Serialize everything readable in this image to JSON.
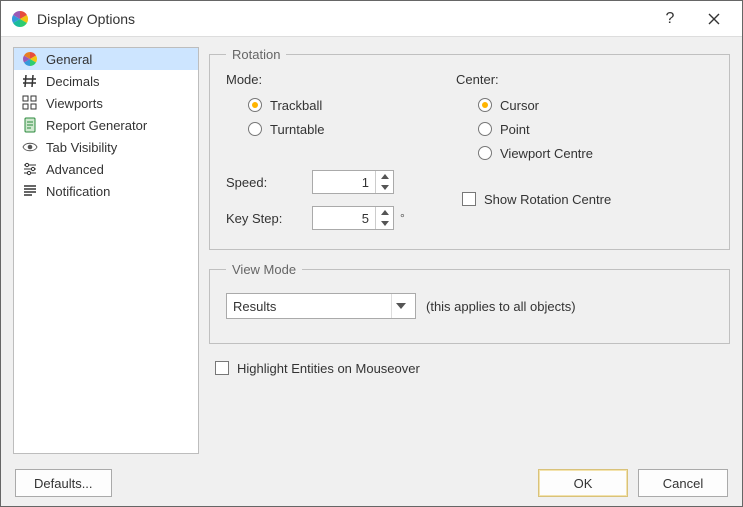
{
  "window": {
    "title": "Display Options"
  },
  "sidebar": {
    "items": [
      {
        "label": "General",
        "selected": true
      },
      {
        "label": "Decimals"
      },
      {
        "label": "Viewports"
      },
      {
        "label": "Report Generator"
      },
      {
        "label": "Tab Visibility"
      },
      {
        "label": "Advanced"
      },
      {
        "label": "Notification"
      }
    ]
  },
  "rotation": {
    "legend": "Rotation",
    "mode_label": "Mode:",
    "mode_options": {
      "trackball": "Trackball",
      "turntable": "Turntable"
    },
    "center_label": "Center:",
    "center_options": {
      "cursor": "Cursor",
      "point": "Point",
      "viewport": "Viewport Centre"
    },
    "speed_label": "Speed:",
    "speed_value": "1",
    "keystep_label": "Key Step:",
    "keystep_value": "5",
    "keystep_unit": "°",
    "show_center_label": "Show Rotation Centre"
  },
  "view_mode": {
    "legend": "View Mode",
    "selected": "Results",
    "note": "(this applies to all objects)"
  },
  "highlight": {
    "label": "Highlight Entities on Mouseover"
  },
  "buttons": {
    "defaults": "Defaults...",
    "ok": "OK",
    "cancel": "Cancel"
  }
}
